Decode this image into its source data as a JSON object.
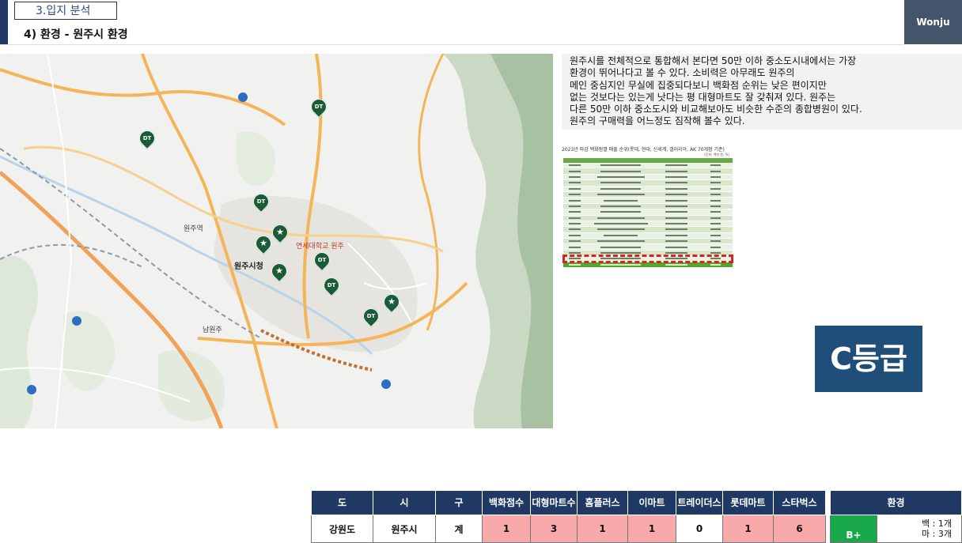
{
  "header": {
    "section": "3.입지 분석",
    "subtitle": "4) 환경  -  원주시 환경",
    "badge": "Wonju"
  },
  "map": {
    "labels": {
      "wonju_city_hall": "원주시청",
      "gangwon_univ": "연세대학교 원주",
      "station": "원주역",
      "namwonju": "남원주"
    },
    "pins": [
      {
        "type": "dt",
        "label": "DT"
      },
      {
        "type": "dt",
        "label": "DT"
      },
      {
        "type": "dt",
        "label": "DT"
      },
      {
        "type": "starbucks",
        "label": "★"
      },
      {
        "type": "starbucks",
        "label": "★"
      },
      {
        "type": "dt",
        "label": "DT"
      },
      {
        "type": "starbucks",
        "label": "★"
      },
      {
        "type": "dt",
        "label": "DT"
      },
      {
        "type": "starbucks",
        "label": "★"
      },
      {
        "type": "dt",
        "label": "DT"
      }
    ]
  },
  "description": [
    "원주시를 전체적으로 통합해서 본다면 50만 이하 중소도시내에서는 가장",
    "환경이 뛰어나다고 볼 수 있다. 소비력은 아무래도 원주의",
    "메인 중심지인 무실에 집중되다보니 백화점 순위는 낮은 편이지만",
    "없는 것보다는 있는게 낫다는 평 대형마트도 잘 갖춰져 있다. 원주는",
    "다른 50만 이하 중소도시와 비교해보아도 비슷한 수준의 종합병원이 있다.",
    "원주의 구매력을 어느정도 짐작해 볼수 있다."
  ],
  "ranking_image": {
    "caption": "2023년 마감 백화점별 매출 순위(롯데, 현대, 신세계, 갤러리아, AK 70개점 기준)",
    "unit": "(단위: 백만 원, %)"
  },
  "grade": "C등급",
  "summary_table": {
    "headers": [
      "도",
      "시",
      "구",
      "백화점수",
      "대형마트수",
      "홈플러스",
      "이마트",
      "트레이더스",
      "롯데마트",
      "스타벅스",
      "환경"
    ],
    "row": {
      "do": "강원도",
      "si": "원주시",
      "gu": "계",
      "dept": "1",
      "mart": "3",
      "homeplus": "1",
      "emart": "1",
      "traders": "0",
      "lotte": "1",
      "starbucks": "6",
      "env_grade": "B+",
      "env_note_1": "백 : 1개",
      "env_note_2": "마 : 3개"
    }
  },
  "colors": {
    "navy": "#1f3864",
    "grade_bg": "#1f4e79",
    "pink": "#f8a9a9",
    "green": "#18a84a",
    "pin": "#1a5c38"
  }
}
